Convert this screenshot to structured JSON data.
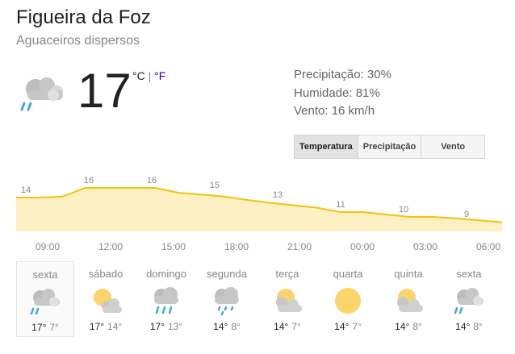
{
  "location": "Figueira da Foz",
  "condition": "Aguaceiros dispersos",
  "current": {
    "icon": "showers-icon",
    "temperature": "17",
    "unit_c": "°C",
    "unit_sep": "|",
    "unit_f": "°F"
  },
  "details": {
    "precipitation": "Precipitação: 30%",
    "humidity": "Humidade: 81%",
    "wind": "Vento: 16 km/h"
  },
  "tabs": [
    {
      "label": "Temperatura",
      "active": true
    },
    {
      "label": "Precipitação",
      "active": false
    },
    {
      "label": "Vento",
      "active": false
    }
  ],
  "chart_data": {
    "type": "area",
    "x": [
      "09:00",
      "12:00",
      "15:00",
      "18:00",
      "21:00",
      "00:00",
      "03:00",
      "06:00"
    ],
    "labels": [
      14,
      16,
      16,
      15,
      13,
      11,
      10,
      9
    ],
    "y": [
      14,
      14,
      14.2,
      16,
      16,
      16,
      16,
      15,
      14.6,
      14.2,
      13.5,
      12.9,
      12.4,
      11.9,
      11,
      11,
      10.5,
      10,
      10,
      9.7,
      9.3,
      8.9
    ],
    "line_color": "#f4c20d",
    "fill_color": "#fdf1c4"
  },
  "forecast": [
    {
      "day": "sexta",
      "icon": "showers-icon",
      "hi": "17°",
      "lo": "7°"
    },
    {
      "day": "sábado",
      "icon": "partly-cloudy-icon",
      "hi": "17°",
      "lo": "14°"
    },
    {
      "day": "domingo",
      "icon": "rain-icon",
      "hi": "17°",
      "lo": "13°"
    },
    {
      "day": "segunda",
      "icon": "light-rain-icon",
      "hi": "14°",
      "lo": "8°"
    },
    {
      "day": "terça",
      "icon": "partly-cloudy-icon",
      "hi": "14°",
      "lo": "7°"
    },
    {
      "day": "quarta",
      "icon": "sunny-icon",
      "hi": "14°",
      "lo": "7°"
    },
    {
      "day": "quinta",
      "icon": "partly-cloudy-icon",
      "hi": "14°",
      "lo": "8°"
    },
    {
      "day": "sexta",
      "icon": "showers-icon",
      "hi": "14°",
      "lo": "8°"
    }
  ]
}
